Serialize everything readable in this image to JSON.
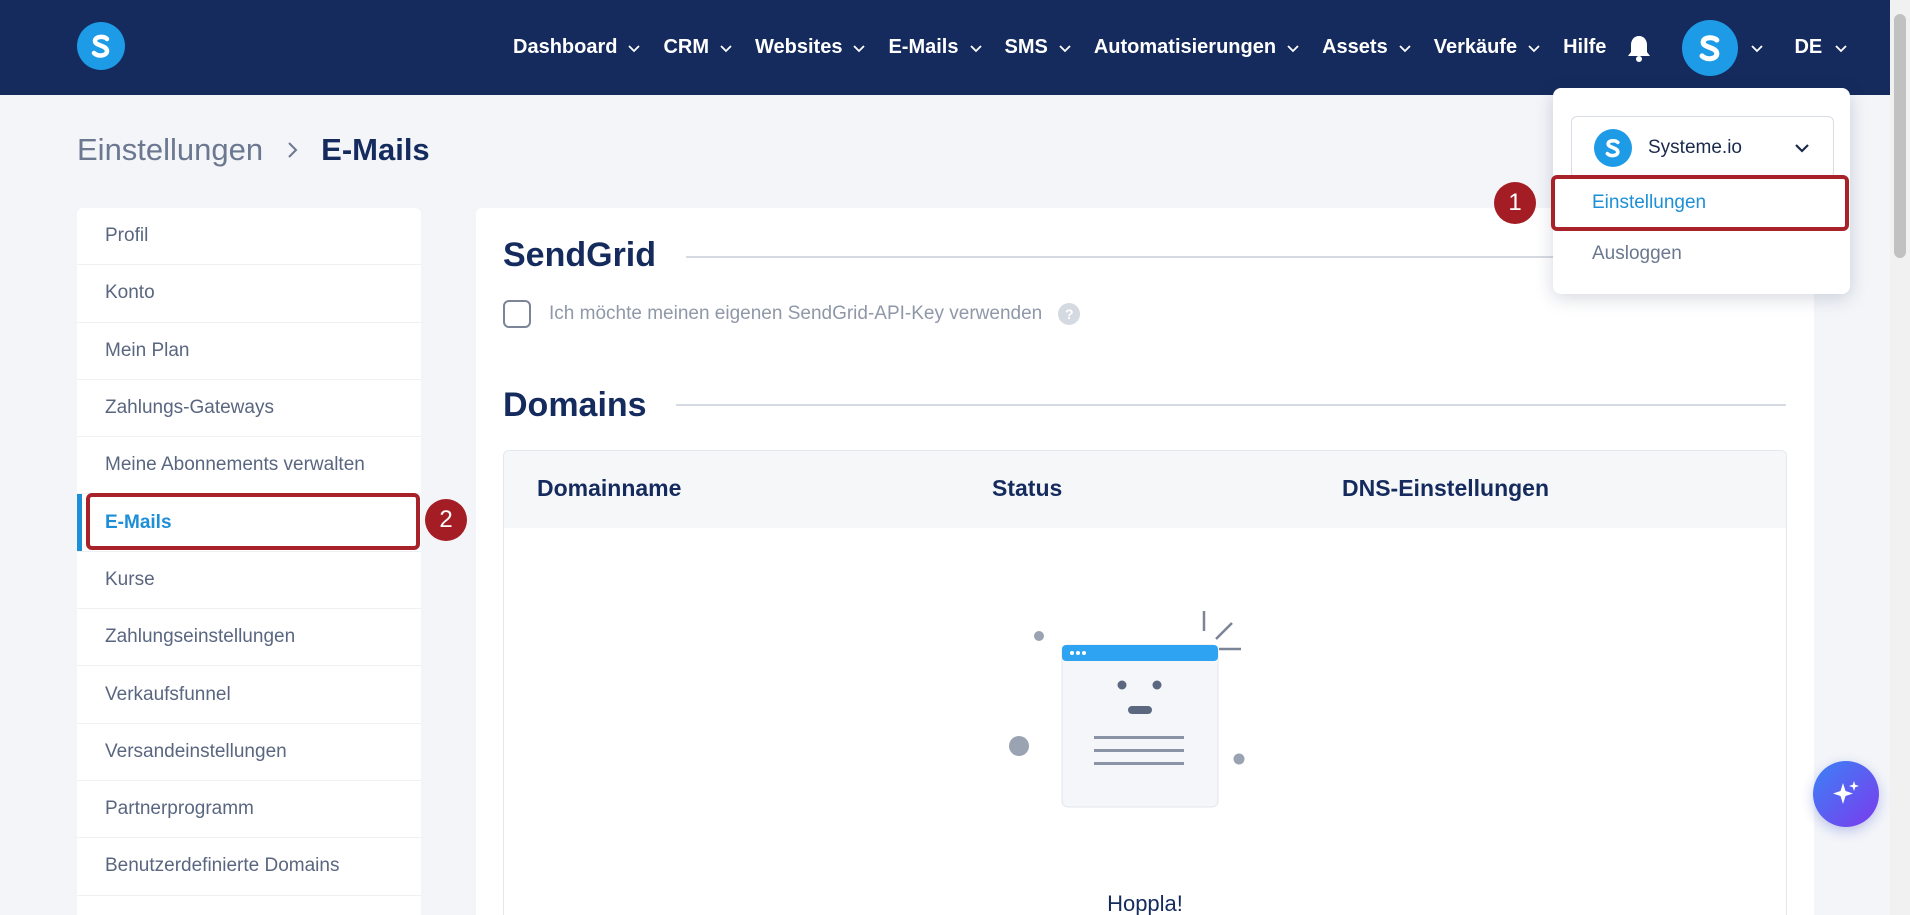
{
  "nav": {
    "items": [
      {
        "label": "Dashboard",
        "id": "dashboard"
      },
      {
        "label": "CRM",
        "id": "crm"
      },
      {
        "label": "Websites",
        "id": "websites"
      },
      {
        "label": "E-Mails",
        "id": "emails"
      },
      {
        "label": "SMS",
        "id": "sms"
      },
      {
        "label": "Automatisierungen",
        "id": "automations"
      },
      {
        "label": "Assets",
        "id": "assets"
      },
      {
        "label": "Verkäufe",
        "id": "sales"
      }
    ],
    "help": "Hilfe",
    "language": "DE"
  },
  "breadcrumb": {
    "parent": "Einstellungen",
    "current": "E-Mails"
  },
  "sidebar": {
    "items": [
      {
        "label": "Profil",
        "active": false
      },
      {
        "label": "Konto",
        "active": false
      },
      {
        "label": "Mein Plan",
        "active": false
      },
      {
        "label": "Zahlungs-Gateways",
        "active": false
      },
      {
        "label": "Meine Abonnements verwalten",
        "active": false
      },
      {
        "label": "E-Mails",
        "active": true
      },
      {
        "label": "Kurse",
        "active": false
      },
      {
        "label": "Zahlungseinstellungen",
        "active": false
      },
      {
        "label": "Verkaufsfunnel",
        "active": false
      },
      {
        "label": "Versandeinstellungen",
        "active": false
      },
      {
        "label": "Partnerprogramm",
        "active": false
      },
      {
        "label": "Benutzerdefinierte Domains",
        "active": false
      }
    ]
  },
  "main": {
    "sendgrid_title": "SendGrid",
    "sendgrid_checkbox_label": "Ich möchte meinen eigenen SendGrid-API-Key verwenden",
    "help_mark": "?",
    "domains_title": "Domains",
    "columns": [
      "Domainname",
      "Status",
      "DNS-Einstellungen"
    ],
    "empty_text": "Hoppla!"
  },
  "dropdown": {
    "account_name": "Systeme.io",
    "settings": "Einstellungen",
    "logout": "Ausloggen"
  },
  "annotations": {
    "step1": "1",
    "step2": "2"
  },
  "colors": {
    "nav_bg": "#152b5e",
    "brand_blue": "#1d9be6",
    "highlight_red": "#a82329",
    "active_blue": "#1d8fd8"
  }
}
